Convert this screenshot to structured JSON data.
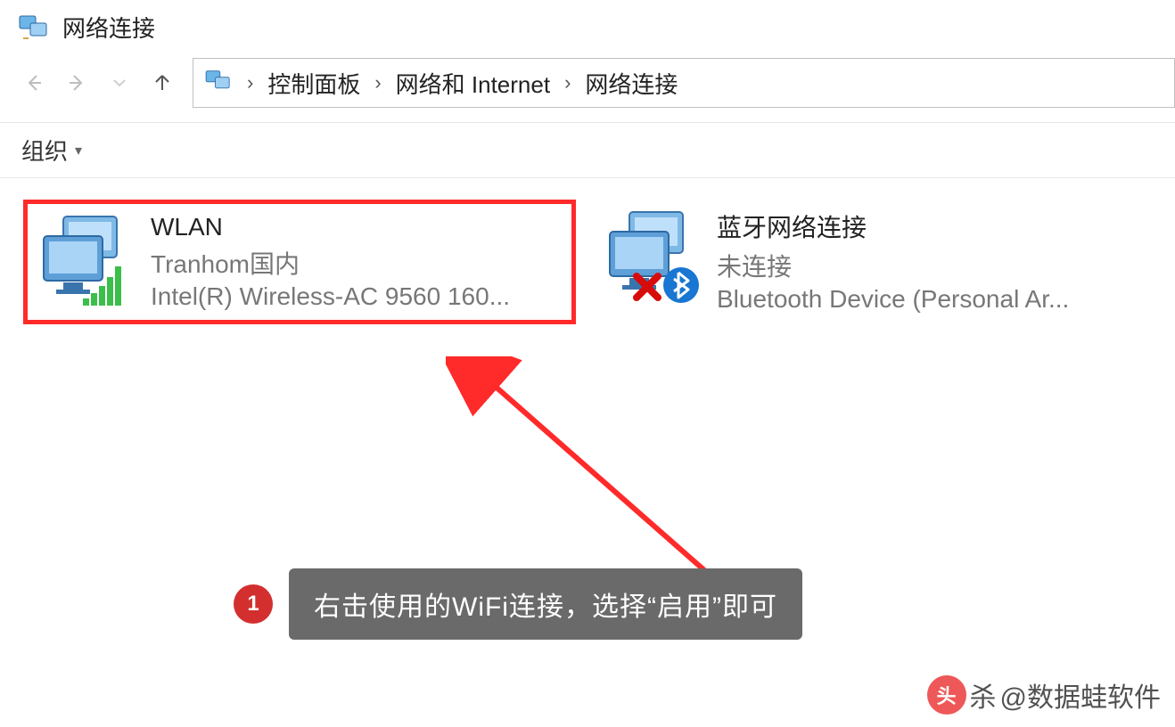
{
  "window": {
    "title": "网络连接"
  },
  "breadcrumb": {
    "items": [
      "控制面板",
      "网络和 Internet",
      "网络连接"
    ]
  },
  "toolbar": {
    "organize": "组织"
  },
  "connections": [
    {
      "name": "WLAN",
      "status": "Tranhom国内",
      "device": "Intel(R) Wireless-AC 9560 160...",
      "highlighted": true,
      "overlay": "wifi"
    },
    {
      "name": "蓝牙网络连接",
      "status": "未连接",
      "device": "Bluetooth Device (Personal Ar...",
      "highlighted": false,
      "overlay": "bt-x"
    }
  ],
  "annotation": {
    "step": "1",
    "text": "右击使用的WiFi连接，选择“启用”即可"
  },
  "watermark": {
    "logo": "头",
    "prefix": "杀",
    "text": "@数据蛙软件"
  }
}
